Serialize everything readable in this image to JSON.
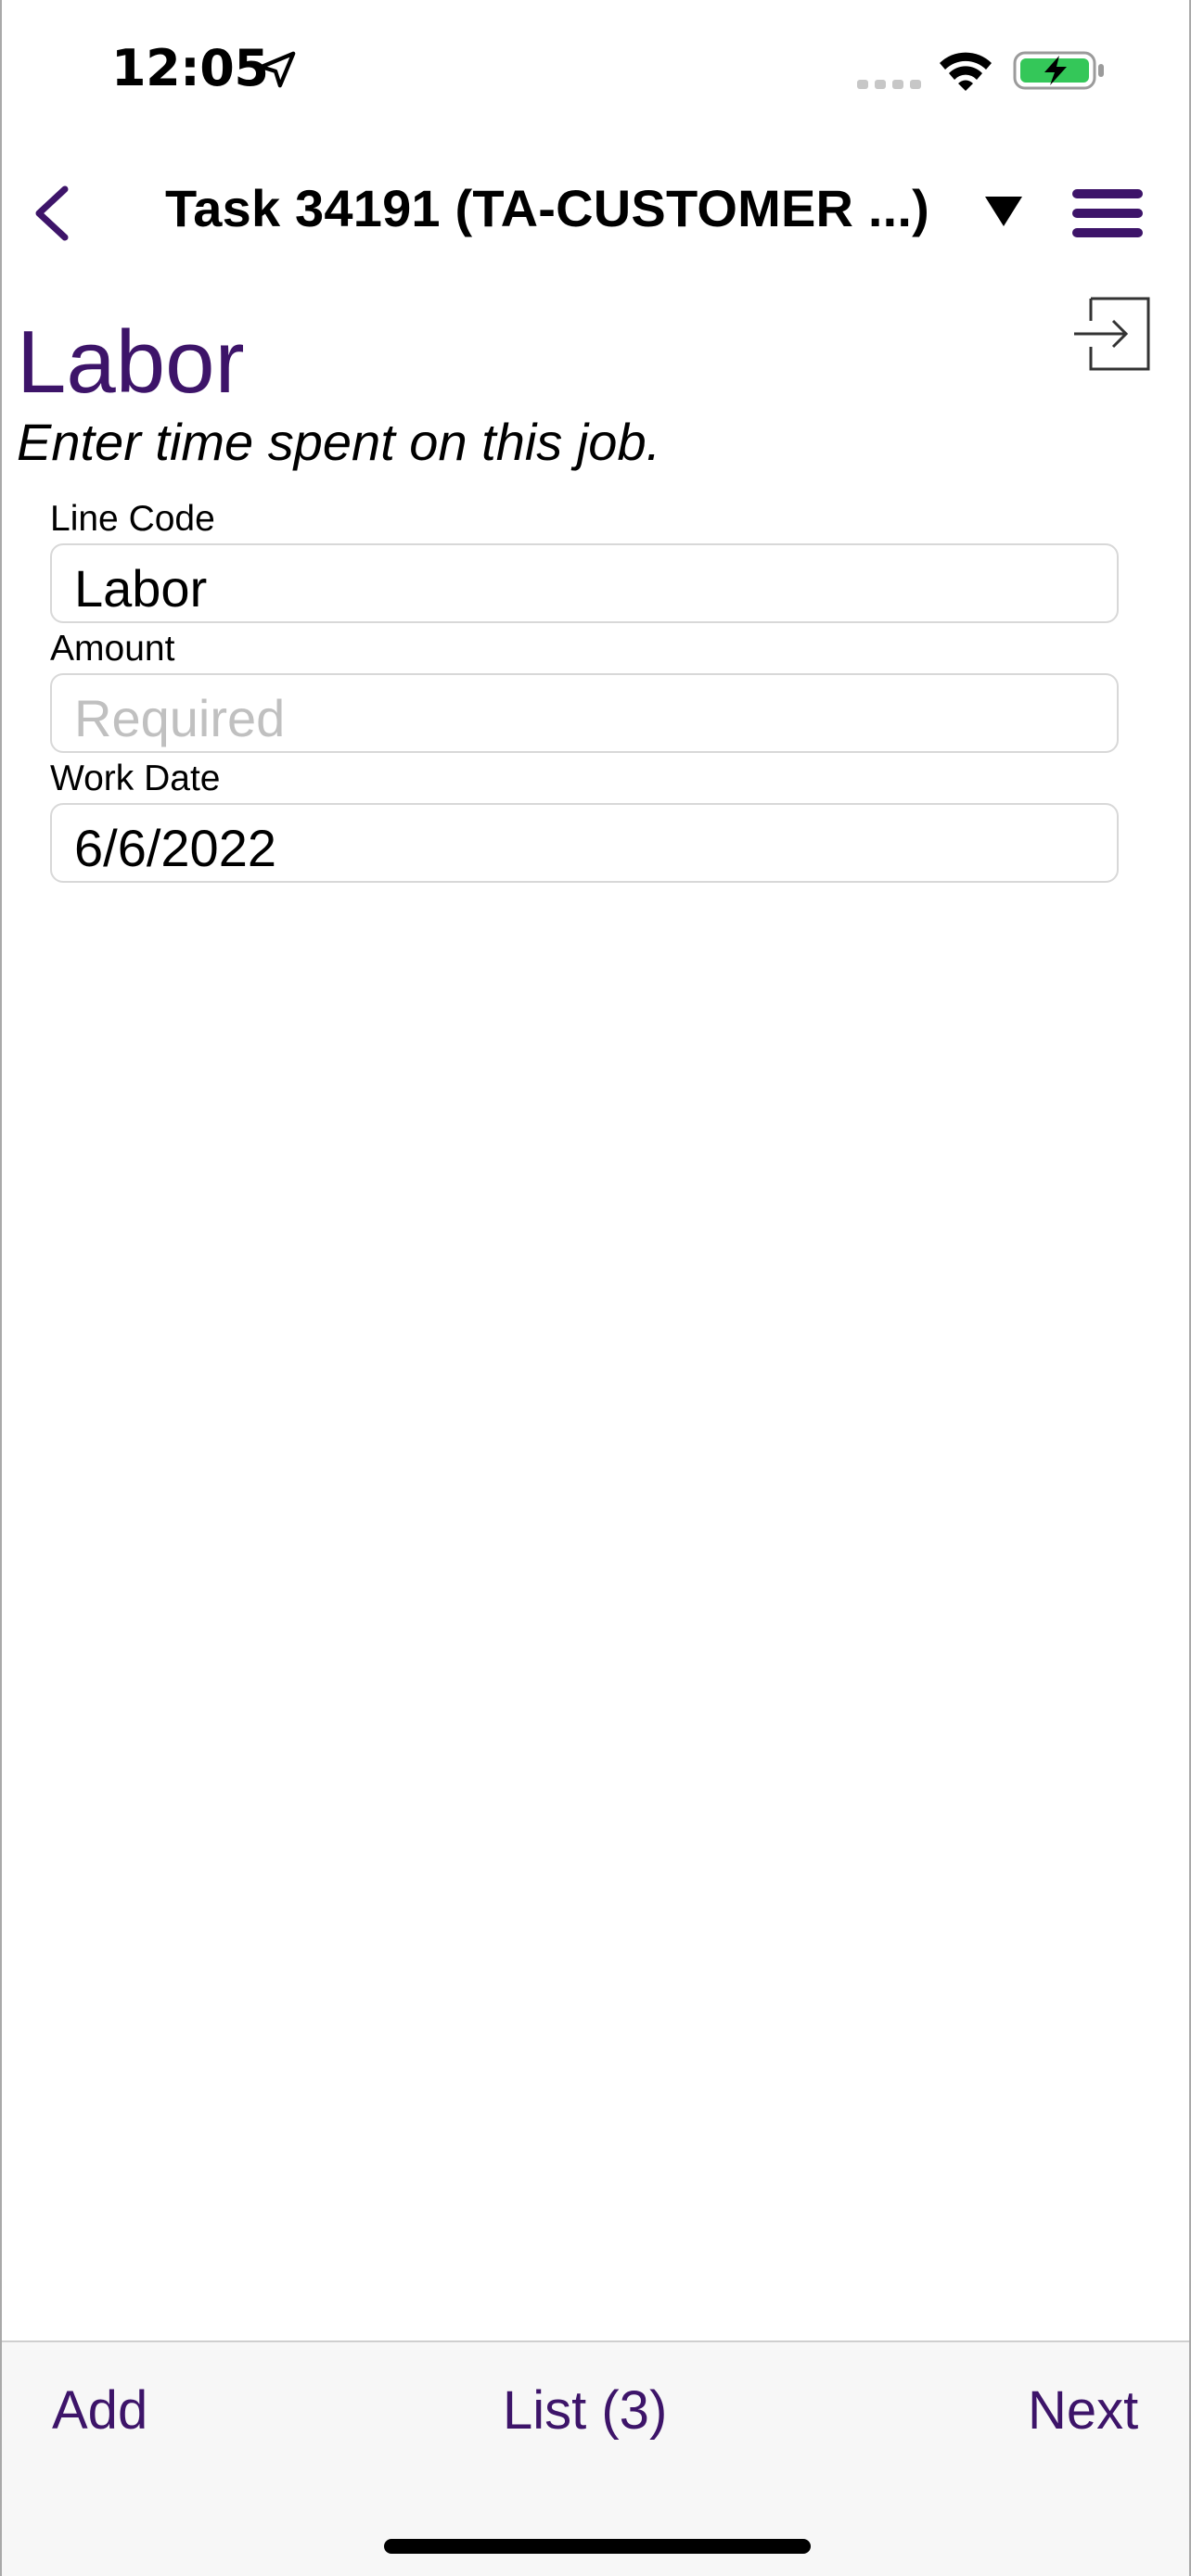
{
  "status_bar": {
    "time": "12:05",
    "icons": [
      "location-arrow-icon",
      "cellular-signal-icon",
      "wifi-icon",
      "battery-charging-icon"
    ],
    "battery_color": "#34c759"
  },
  "nav": {
    "title": "Task 34191 (TA-CUSTOMER ...)",
    "back_icon": "chevron-left-icon",
    "dropdown_glyph": "▼",
    "menu_icon": "hamburger-menu-icon"
  },
  "header": {
    "title": "Labor",
    "subtitle": "Enter time spent on this job.",
    "exit_icon": "sign-in-arrow-icon"
  },
  "form": {
    "line_code": {
      "label": "Line Code",
      "value": "Labor"
    },
    "amount": {
      "label": "Amount",
      "value": "",
      "placeholder": "Required"
    },
    "work_date": {
      "label": "Work Date",
      "value": "6/6/2022"
    }
  },
  "toolbar": {
    "add_label": "Add",
    "list_label": "List (3)",
    "next_label": "Next"
  },
  "colors": {
    "accent": "#3d1469",
    "placeholder": "#c0c0c0",
    "toolbar_bg": "#f7f7f7"
  }
}
